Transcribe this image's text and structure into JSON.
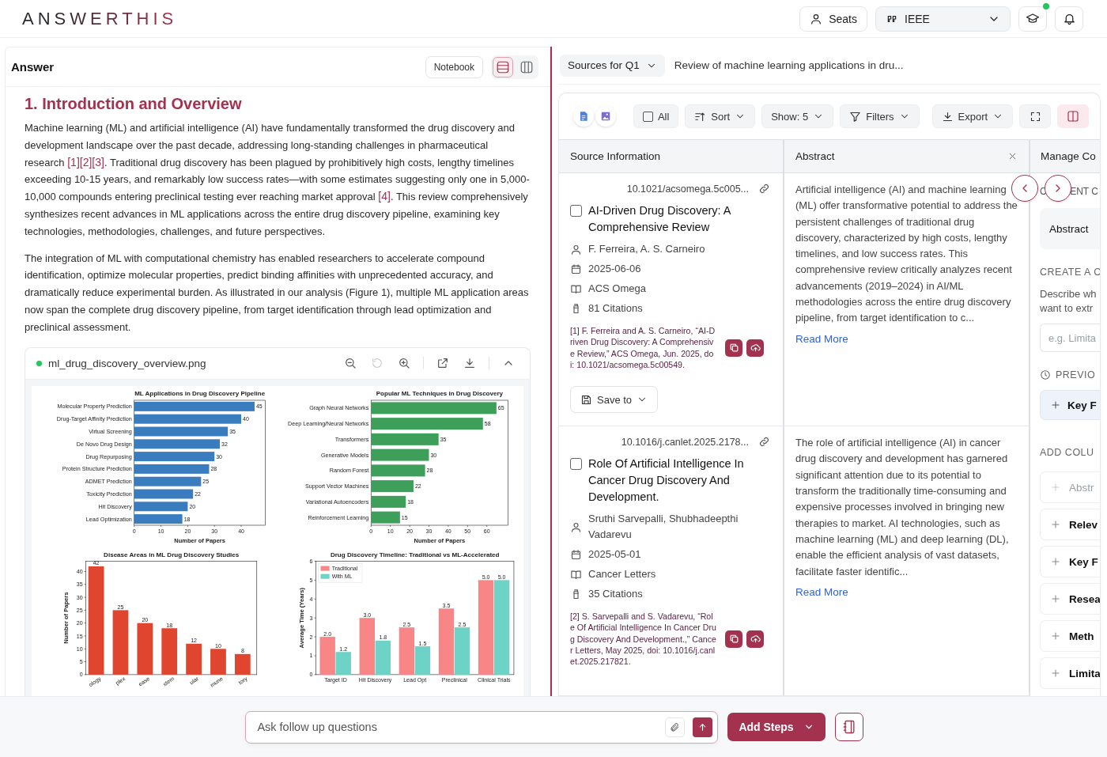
{
  "header": {
    "logo": "ANSWERTHIS",
    "seats_button": "Seats",
    "style_select": "IEEE",
    "learn_notification": true
  },
  "answer": {
    "title": "Answer",
    "notebook_button": "Notebook",
    "view_toggles": [
      {
        "kind": "rows",
        "selected": true
      },
      {
        "kind": "columns",
        "selected": false
      }
    ],
    "heading": "1. Introduction and Overview",
    "paragraphs": [
      [
        {
          "kind": "text",
          "text": "Machine learning (ML) and artificial intelligence (AI) have fundamentally transformed the drug discovery and development landscape over the past decade, addressing long-standing challenges in pharmaceutical research "
        },
        {
          "kind": "cite",
          "text": "[1]"
        },
        {
          "kind": "cite",
          "text": "[2]"
        },
        {
          "kind": "cite",
          "text": "[3]"
        },
        {
          "kind": "text",
          "text": ". Traditional drug discovery has been plagued by prohibitively high costs, lengthy timelines exceeding 10-15 years, and remarkably low success rates—with some estimates suggesting only one in 5,000-10,000 compounds entering preclinical testing ever reaching market approval "
        },
        {
          "kind": "cite",
          "text": "[4]"
        },
        {
          "kind": "text",
          "text": ". This review comprehensively synthesizes recent advances in ML applications across the entire drug discovery pipeline, examining key technologies, methodologies, challenges, and future perspectives."
        }
      ],
      [
        {
          "kind": "text",
          "text": "The integration of ML with computational chemistry has enabled researchers to accelerate compound identification, optimize molecular properties, predict binding affinities with unprecedented accuracy, and dramatically reduce experimental burden. As illustrated in our analysis (Figure 1), multiple ML application areas now span the complete drug discovery pipeline, from target identification through lead optimization and preclinical assessment."
        }
      ]
    ],
    "figure": {
      "filename": "ml_drug_discovery_overview.png",
      "tools": [
        {
          "kind": "zoom-out",
          "disabled": false
        },
        {
          "kind": "reset",
          "disabled": true
        },
        {
          "kind": "zoom-in",
          "disabled": false
        },
        {
          "kind": "open",
          "disabled": false
        },
        {
          "kind": "download",
          "disabled": false
        },
        {
          "kind": "collapse",
          "disabled": false
        }
      ],
      "charts": [
        {
          "chart_data": {
            "type": "bar",
            "orientation": "horizontal",
            "title": "ML Applications in Drug Discovery Pipeline",
            "xlabel": "Number of Papers",
            "categories": [
              "Molecular Property Prediction",
              "Drug-Target Affinity Prediction",
              "Virtual Screening",
              "De Novo Drug Design",
              "Drug Repurposing",
              "Protein Structure Prediction",
              "ADMET Prediction",
              "Toxicity Prediction",
              "Hit Discovery",
              "Lead Optimization"
            ],
            "series": [
              {
                "color": "#3a7dbf",
                "values": [
                  45,
                  40,
                  35,
                  32,
                  30,
                  28,
                  25,
                  22,
                  20,
                  18
                ]
              }
            ],
            "xlim": [
              0,
              49
            ],
            "xticks": [
              0,
              10,
              20,
              30,
              40
            ],
            "data_labels": true
          }
        },
        {
          "chart_data": {
            "type": "bar",
            "orientation": "horizontal",
            "title": "Popular ML Techniques in Drug Discovery",
            "xlabel": "Number of Papers",
            "categories": [
              "Graph Neural Networks",
              "Deep Learning/Neural Networks",
              "Transformers",
              "Generative Models",
              "Random Forest",
              "Support Vector Machines",
              "Variational Autoencoders",
              "Reinforcement Learning"
            ],
            "series": [
              {
                "color": "#3d9f5a",
                "values": [
                  65,
                  58,
                  35,
                  30,
                  28,
                  22,
                  18,
                  15
                ]
              }
            ],
            "xlim": [
              0,
              71
            ],
            "xticks": [
              0,
              10,
              20,
              30,
              40,
              50,
              60
            ],
            "data_labels": true
          }
        },
        {
          "chart_data": {
            "type": "bar",
            "orientation": "vertical",
            "title": "Disease Areas in ML Drug Discovery Studies",
            "ylabel": "Number of Papers",
            "categories": [
              "ology",
              "plex",
              "ease",
              "stem",
              "ular",
              "mune",
              "tory"
            ],
            "series": [
              {
                "color": "#e0452f",
                "values": [
                  42,
                  25,
                  20,
                  18,
                  12,
                  10,
                  8
                ]
              }
            ],
            "ylim": [
              0,
              44
            ],
            "yticks": [
              0,
              5,
              10,
              15,
              20,
              25,
              30,
              35,
              40
            ],
            "data_labels": true
          }
        },
        {
          "chart_data": {
            "type": "bar",
            "orientation": "vertical",
            "title": "Drug Discovery Timeline: Traditional vs ML-Accelerated",
            "ylabel": "Average Time (Years)",
            "categories": [
              "Target ID",
              "Hit Discovery",
              "Lead Opt",
              "Preclinical",
              "Clinical Trials"
            ],
            "series": [
              {
                "name": "Traditional",
                "color": "#f98686",
                "values": [
                  2.0,
                  3.0,
                  2.5,
                  3.5,
                  5.0
                ]
              },
              {
                "name": "With ML",
                "color": "#6dd3c7",
                "values": [
                  1.2,
                  1.8,
                  1.5,
                  2.5,
                  5.0
                ]
              }
            ],
            "ylim": [
              0,
              6
            ],
            "yticks": [
              0,
              1,
              2,
              3,
              4,
              5,
              6
            ],
            "legend": "upper left",
            "value_labels": [
              [
                "2.0",
                "3.0",
                "2.5",
                "3.5",
                "5.0"
              ],
              [
                "1.2",
                "1.8",
                "1.5",
                "2.5",
                "5.0"
              ]
            ]
          }
        }
      ]
    }
  },
  "sources": {
    "query_select": "Sources for Q1",
    "query_title": "Review of machine learning applications in dru...",
    "view_toggles": [
      {
        "kind": "document"
      },
      {
        "kind": "image"
      }
    ],
    "select_all": {
      "label": "All",
      "checked": false
    },
    "sort_button": "Sort",
    "show_select": "Show: 5",
    "filters_button": "Filters",
    "export_button": "Export",
    "split_view": {
      "selected": true
    },
    "columns": [
      "Source Information",
      "Abstract",
      "Manage Co"
    ],
    "rows": [
      {
        "doi": "10.1021/acsomega.5c005...",
        "checked": false,
        "title": "AI-Driven Drug Discovery: A Comprehensive Review",
        "authors": "F. Ferreira, A. S. Carneiro",
        "date": "2025-06-06",
        "journal": "ACS Omega",
        "citations": "81 Citations",
        "reference": "[1] F. Ferreira and A. S. Carneiro, “AI-Driven Drug Discovery: A Comprehensive Review,” ACS Omega, Jun. 2025, doi: 10.1021/acsomega.5c00549.",
        "save_button": "Save to",
        "abstract": "Artificial intelligence (AI) and machine learning (ML) offer transformative potential to address the persistent challenges of traditional drug discovery, characterized by high costs, lengthy timelines, and low success rates. This comprehensive review critically analyzes recent advancements (2019–2024) in AI/ML methodologies across the entire drug discovery pipeline, from target identification to c...",
        "read_more": "Read More"
      },
      {
        "doi": "10.1016/j.canlet.2025.2178...",
        "checked": false,
        "title": "Role Of Artificial Intelligence In Cancer Drug Discovery And Development.",
        "authors": "Sruthi Sarvepalli, Shubhadeepthi Vadarevu",
        "date": "2025-05-01",
        "journal": "Cancer Letters",
        "citations": "35 Citations",
        "reference": "[2] S. Sarvepalli and S. Vadarevu, “Role Of Artificial Intelligence In Cancer Drug Discovery And Development.,” Cancer Letters, May 2025, doi: 10.1016/j.canlet.2025.217821.",
        "abstract": "The role of artificial intelligence (AI) in cancer drug discovery and development has garnered significant attention due to its potential to transform the traditionally time-consuming and expensive processes involved in bringing new therapies to market. AI technologies, such as machine learning (ML) and deep learning (DL), enable the efficient analysis of vast datasets, facilitate faster identific...",
        "read_more": "Read More"
      }
    ],
    "manage": {
      "current_label_start": "C",
      "current_label_end": "ENT C",
      "chips": [
        "Abstract"
      ],
      "create_heading": "CREATE A C",
      "describe_lines": [
        "Describe wh",
        "want to extr"
      ],
      "placeholder": "e.g. Limita",
      "previous_heading": "PREVIO",
      "previous_items": [
        "Key F"
      ],
      "add_heading": "ADD COLU",
      "add_items": [
        {
          "label": "Abstr",
          "disabled": true
        },
        {
          "label": "Relev",
          "disabled": false
        },
        {
          "label": "Key F",
          "disabled": false
        },
        {
          "label": "Resea",
          "disabled": false
        },
        {
          "label": "Meth",
          "disabled": false
        },
        {
          "label": "Limita",
          "disabled": false
        }
      ]
    }
  },
  "chat": {
    "placeholder": "Ask follow up questions",
    "add_steps_button": "Add Steps"
  }
}
